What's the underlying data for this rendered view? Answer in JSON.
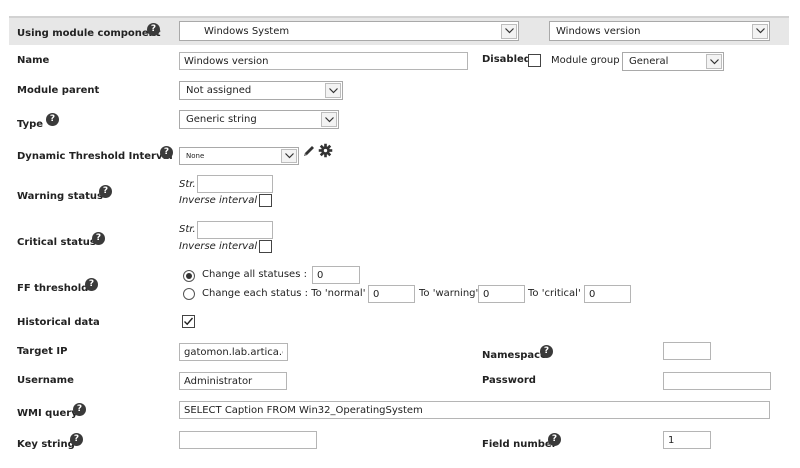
{
  "module_component": {
    "label": "Using module component",
    "selected_group": "Windows System",
    "selected_component": "Windows version"
  },
  "name": {
    "label": "Name",
    "value": "Windows version"
  },
  "disabled": {
    "label": "Disabled",
    "checked": false
  },
  "module_group": {
    "label": "Module group",
    "value": "General"
  },
  "module_parent": {
    "label": "Module parent",
    "value": "Not assigned"
  },
  "type": {
    "label": "Type",
    "value": "Generic string"
  },
  "dynamic_threshold": {
    "label": "Dynamic Threshold Interval",
    "value": "None"
  },
  "warning_status": {
    "label": "Warning status",
    "str_label": "Str.",
    "str_value": "",
    "inverse_label": "Inverse interval",
    "inverse_checked": false
  },
  "critical_status": {
    "label": "Critical status",
    "str_label": "Str.",
    "str_value": "",
    "inverse_label": "Inverse interval",
    "inverse_checked": false
  },
  "ff_threshold": {
    "label": "FF threshold",
    "change_all_label": "Change all statuses :",
    "change_all_value": "0",
    "change_each_label": "Change each status : To 'normal'",
    "normal_value": "0",
    "to_warning_label": "To 'warning'",
    "warning_value": "0",
    "to_critical_label": "To 'critical'",
    "critical_value": "0",
    "selected": "all"
  },
  "historical_data": {
    "label": "Historical data",
    "checked": true
  },
  "target_ip": {
    "label": "Target IP",
    "value": "gatomon.lab.artica.e"
  },
  "namespace": {
    "label": "Namespace",
    "value": ""
  },
  "username": {
    "label": "Username",
    "value": "Administrator"
  },
  "password": {
    "label": "Password",
    "value": ""
  },
  "wmi_query": {
    "label": "WMI query",
    "value": "SELECT Caption FROM Win32_OperatingSystem"
  },
  "key_string": {
    "label": "Key string",
    "value": ""
  },
  "field_number": {
    "label": "Field number",
    "value": "1"
  },
  "icons": {
    "help": "help-icon",
    "edit": "pencil-icon",
    "settings": "gear-icon"
  }
}
